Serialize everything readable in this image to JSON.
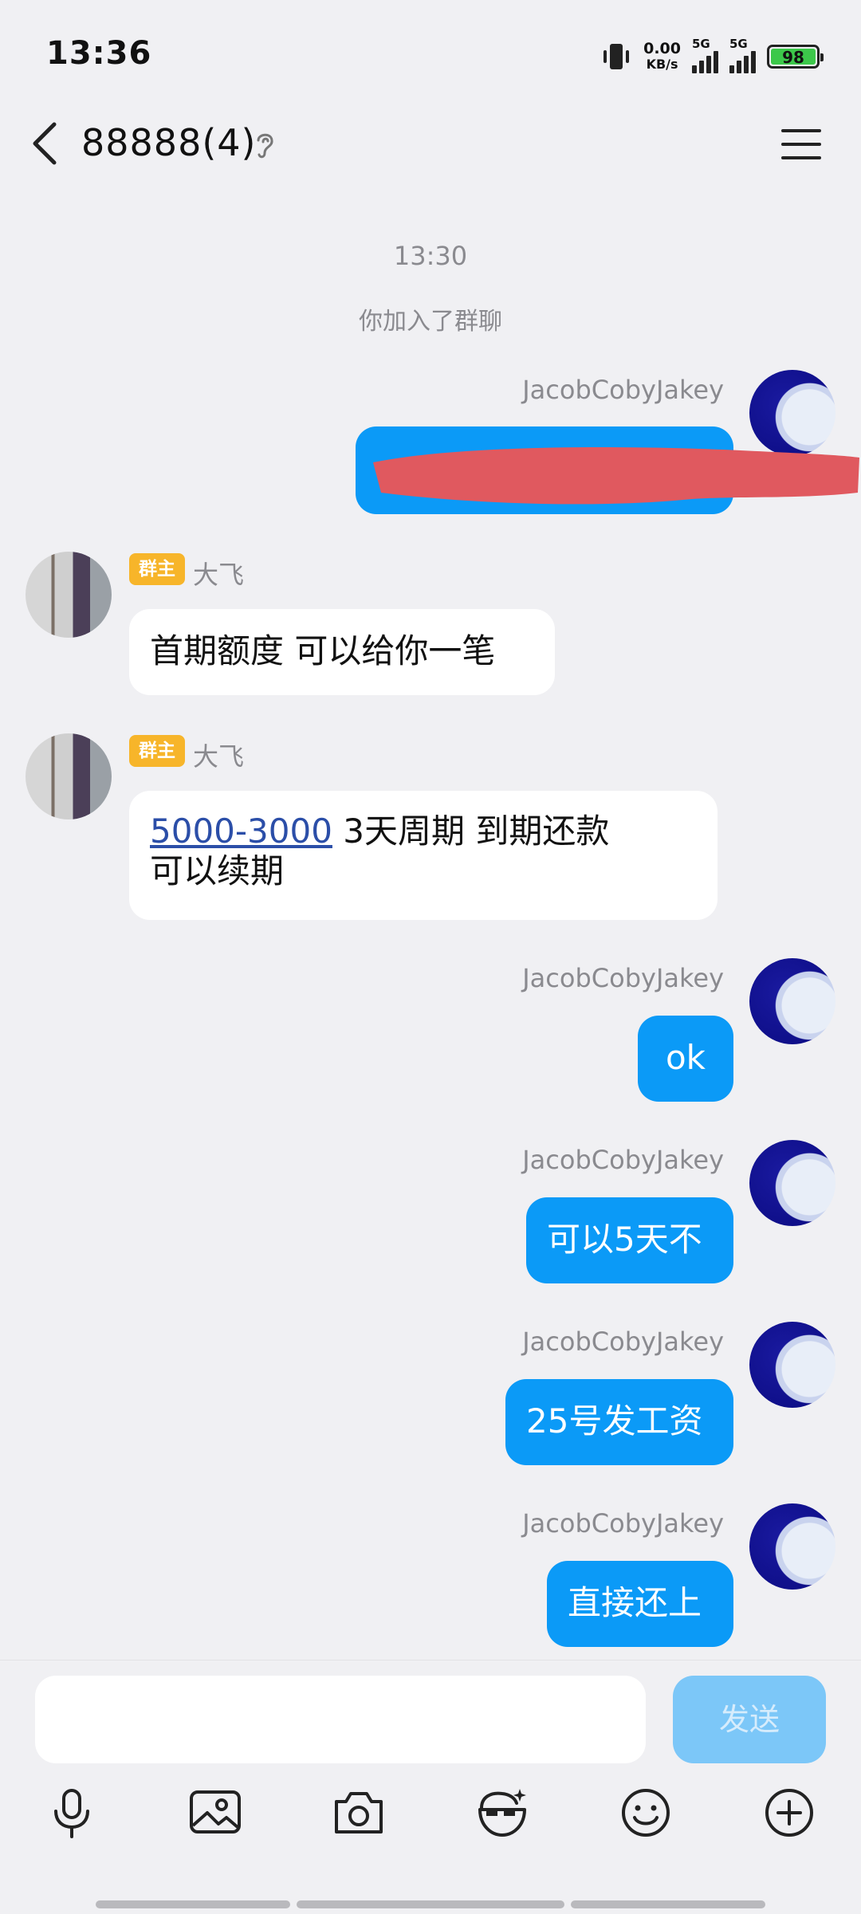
{
  "status_bar": {
    "time": "13:36",
    "net_speed_value": "0.00",
    "net_speed_unit": "KB/s",
    "signal_1_label": "5G",
    "signal_2_label": "5G",
    "battery_level": "98"
  },
  "header": {
    "title": "88888(4)"
  },
  "messages": {
    "timestamp": "13:30",
    "system_note": "你加入了群聊",
    "m1": {
      "sender": "JacobCobyJakey",
      "text": ""
    },
    "m2": {
      "badge": "群主",
      "sender": "大飞",
      "text": "首期额度  可以给你一笔"
    },
    "m3": {
      "badge": "群主",
      "sender": "大飞",
      "link": "5000-3000",
      "text_after_link": "   3天周期 到期还款",
      "line2": "可以续期"
    },
    "m4": {
      "sender": "JacobCobyJakey",
      "text": "ok"
    },
    "m5": {
      "sender": "JacobCobyJakey",
      "text": "可以5天不"
    },
    "m6": {
      "sender": "JacobCobyJakey",
      "text": "25号发工资"
    },
    "m7": {
      "sender": "JacobCobyJakey",
      "text": "直接还上"
    }
  },
  "composer": {
    "input_value": "",
    "send_label": "发送"
  },
  "toolbar_icons": [
    "microphone-icon",
    "image-icon",
    "camera-icon",
    "sticker-icon",
    "emoji-icon",
    "plus-icon"
  ],
  "colors": {
    "my_bubble": "#0b9af7",
    "other_bubble": "#ffffff",
    "badge": "#f7b52a",
    "send_disabled": "#7cc7f8",
    "redaction": "#e0595f"
  }
}
